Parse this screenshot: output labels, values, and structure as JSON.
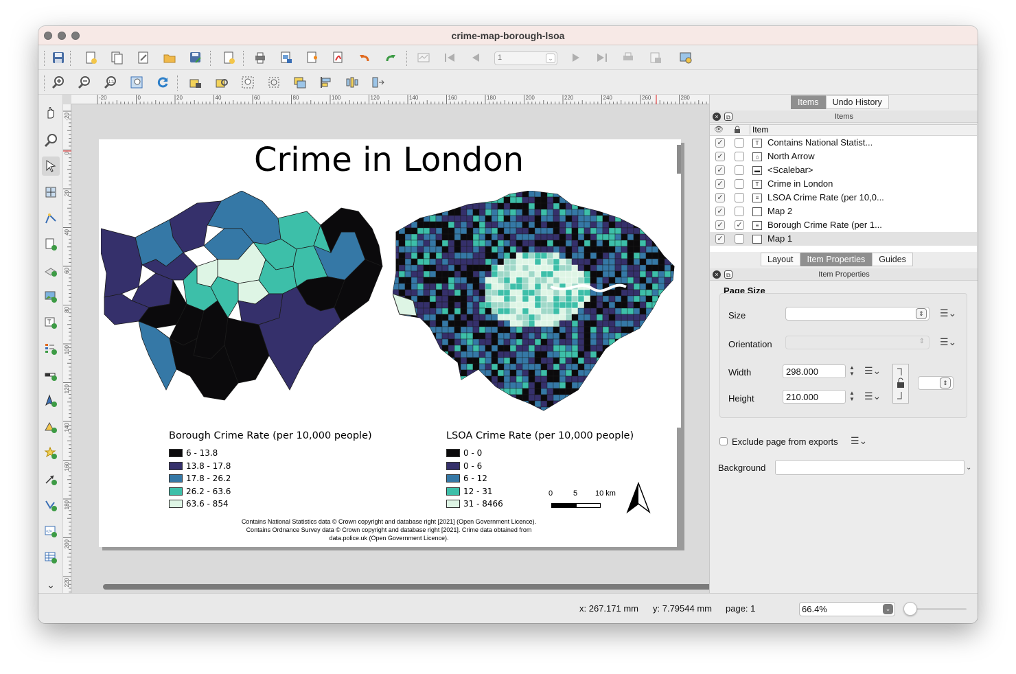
{
  "window": {
    "title": "crime-map-borough-lsoa"
  },
  "toolbar": {
    "page_number": "1"
  },
  "layout": {
    "title": "Crime in London",
    "borough_legend": {
      "title": "Borough Crime Rate (per 10,000 people)",
      "items": [
        {
          "label": "6 - 13.8",
          "color": "#0b0a0c"
        },
        {
          "label": "13.8 - 17.8",
          "color": "#35306b"
        },
        {
          "label": "17.8 - 26.2",
          "color": "#3578a6"
        },
        {
          "label": "26.2 - 63.6",
          "color": "#3dbfa9"
        },
        {
          "label": "63.6 - 854",
          "color": "#def5e5"
        }
      ]
    },
    "lsoa_legend": {
      "title": "LSOA Crime Rate (per 10,000 people)",
      "items": [
        {
          "label": "0 - 0",
          "color": "#0b0a0c"
        },
        {
          "label": "0 - 6",
          "color": "#35306b"
        },
        {
          "label": "6 - 12",
          "color": "#3578a6"
        },
        {
          "label": "12 - 31",
          "color": "#3dbfa9"
        },
        {
          "label": "31 - 8466",
          "color": "#def5e5"
        }
      ]
    },
    "scalebar": {
      "labels": [
        "0",
        "5",
        "10 km"
      ]
    },
    "credits": [
      "Contains National Statistics data © Crown copyright and database right [2021] (Open Government Licence).",
      "Contains Ordnance Survey data © Crown copyright and database right [2021]. Crime data obtained from",
      "data.police.uk (Open Government Licence)."
    ]
  },
  "ruler": {
    "horizontal": [
      "-20",
      "0",
      "20",
      "40",
      "60",
      "80",
      "100",
      "120",
      "140",
      "160",
      "180",
      "200",
      "220",
      "240",
      "260",
      "280"
    ],
    "vertical": [
      "-20",
      "0",
      "20",
      "40",
      "60",
      "80",
      "100",
      "120",
      "140",
      "160",
      "180",
      "200",
      "220"
    ]
  },
  "panel": {
    "top_tabs": [
      "Items",
      "Undo History"
    ],
    "items_header": "Items",
    "item_column": "Item",
    "items": [
      {
        "name": "Contains National Statist...",
        "visible": true,
        "locked": false,
        "type": "T"
      },
      {
        "name": "North Arrow",
        "visible": true,
        "locked": false,
        "type": "img"
      },
      {
        "name": "<Scalebar>",
        "visible": true,
        "locked": false,
        "type": "scale"
      },
      {
        "name": "Crime in London",
        "visible": true,
        "locked": false,
        "type": "T"
      },
      {
        "name": "LSOA Crime Rate (per 10,0...",
        "visible": true,
        "locked": false,
        "type": "legend"
      },
      {
        "name": "Map 2",
        "visible": true,
        "locked": false,
        "type": "map"
      },
      {
        "name": "Borough Crime Rate (per 1...",
        "visible": true,
        "locked": true,
        "type": "legend"
      },
      {
        "name": "Map 1",
        "visible": true,
        "locked": false,
        "type": "map"
      }
    ],
    "bottom_tabs": [
      "Layout",
      "Item Properties",
      "Guides"
    ],
    "props_header": "Item Properties",
    "page_size": {
      "section": "Page Size",
      "size_label": "Size",
      "orientation_label": "Orientation",
      "width_label": "Width",
      "width_value": "298.000",
      "height_label": "Height",
      "height_value": "210.000"
    },
    "exclude_label": "Exclude page from exports",
    "background_label": "Background"
  },
  "status": {
    "x": "x: 267.171 mm",
    "y": "y: 7.79544 mm",
    "page": "page: 1",
    "zoom": "66.4%"
  }
}
